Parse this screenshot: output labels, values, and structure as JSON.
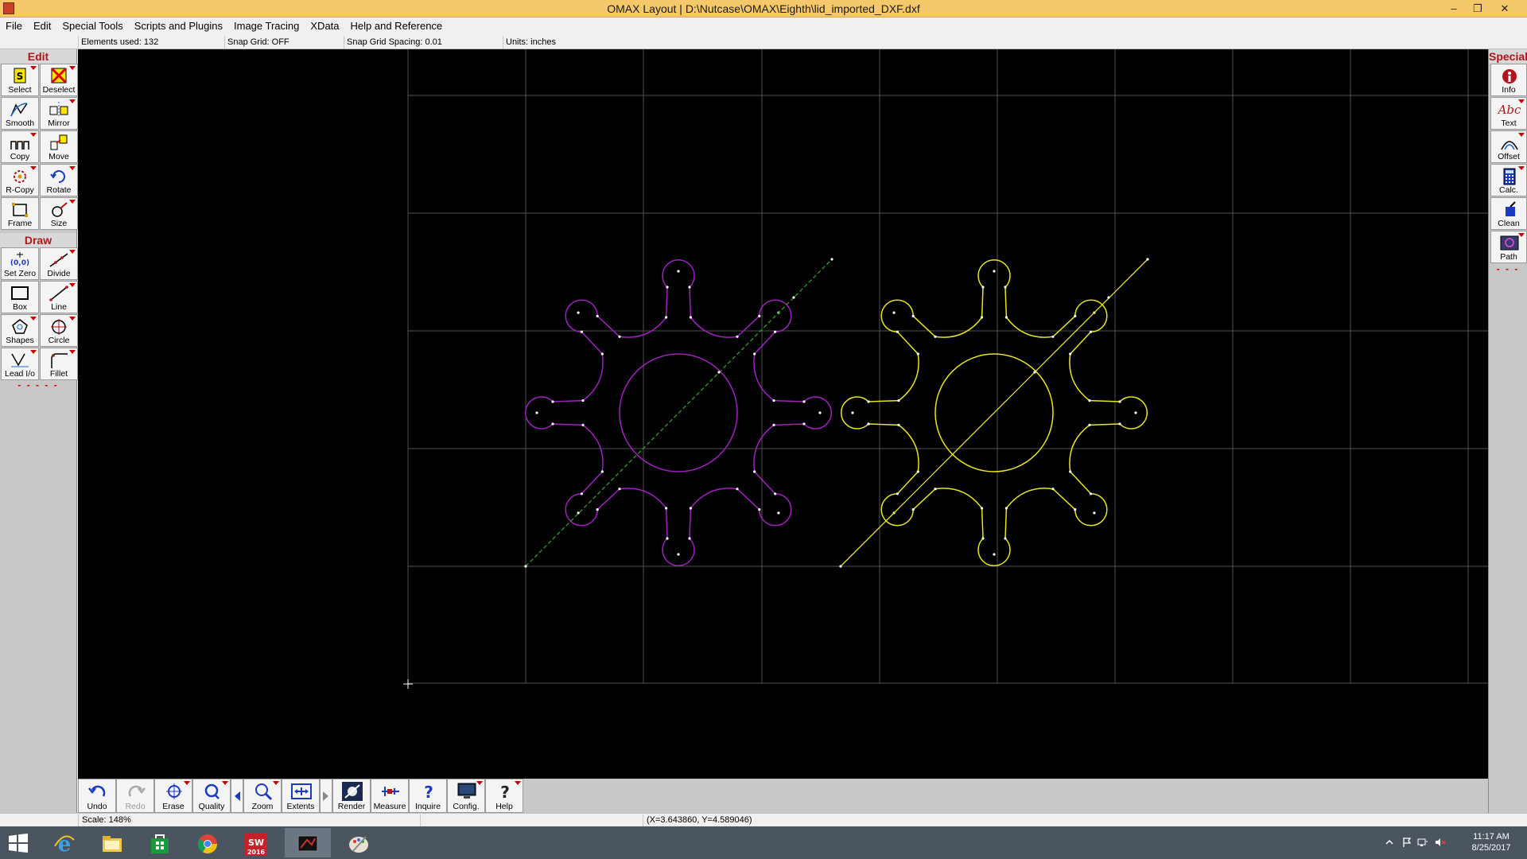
{
  "window": {
    "title": "OMAX Layout | D:\\Nutcase\\OMAX\\Eighth\\lid_imported_DXF.dxf",
    "minimize_glyph": "–",
    "restore_glyph": "❐",
    "close_glyph": "✕"
  },
  "menu": {
    "items": [
      "File",
      "Edit",
      "Special Tools",
      "Scripts and Plugins",
      "Image Tracing",
      "XData",
      "Help and Reference"
    ]
  },
  "info": {
    "elements_used": "Elements used: 132",
    "snap_grid": "Snap Grid: OFF",
    "snap_spacing": "Snap Grid Spacing: 0.01",
    "units": "Units: inches"
  },
  "left_toolbar": {
    "edit_header": "Edit",
    "draw_header": "Draw",
    "dashes": "- - - - -",
    "edit_buttons": [
      "Select",
      "Deselect",
      "Smooth",
      "Mirror",
      "Copy",
      "Move",
      "R-Copy",
      "Rotate",
      "Frame",
      "Size"
    ],
    "draw_buttons": [
      "Set Zero",
      "Divide",
      "Box",
      "Line",
      "Shapes",
      "Circle",
      "Lead I/o",
      "Fillet"
    ]
  },
  "right_toolbar": {
    "header": "Special",
    "dashes": "- - -",
    "buttons": [
      "Info",
      "Text",
      "Offset",
      "Calc.",
      "Clean",
      "Path"
    ],
    "text_icon_glyph": "Abc"
  },
  "bottom_toolbar": {
    "buttons": [
      "Undo",
      "Redo",
      "Erase",
      "Quality",
      "Zoom",
      "Extents",
      "Render",
      "Measure",
      "Inquire",
      "Config.",
      "Help"
    ]
  },
  "status": {
    "scale": "Scale: 148%",
    "coords": "(X=3.643860, Y=4.589046)"
  },
  "taskbar": {
    "time": "11:17 AM",
    "date": "8/25/2017",
    "sw_label": "2016"
  },
  "colors": {
    "canvas": "#000000",
    "grid": "#555555",
    "gear_left": "#a020c0",
    "gear_right": "#e6e61e",
    "guide_left": "#2e9a2e",
    "accent_red": "#b0151b"
  }
}
